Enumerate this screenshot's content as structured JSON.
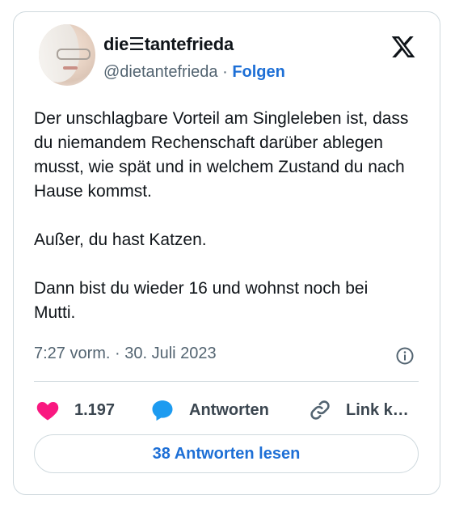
{
  "author": {
    "display_name": "die☰tantefrieda",
    "handle": "@dietantefrieda",
    "separator": "·",
    "follow_label": "Folgen"
  },
  "tweet": {
    "text": "Der unschlagbare Vorteil am Singleleben ist, dass du niemandem Rechenschaft darüber ablegen musst, wie spät und in welchem Zustand du nach Hause kommst.\n\nAußer, du hast Katzen.\n\nDann bist du wieder 16 und wohnst noch bei Mutti.",
    "timestamp": "7:27 vorm. · 30. Juli 2023"
  },
  "actions": {
    "like_count": "1.197",
    "reply_label": "Antworten",
    "link_label": "Link k…"
  },
  "read_replies_label": "38 Antworten lesen",
  "icons": {
    "brand": "x-logo-icon",
    "info": "info-icon",
    "like": "heart-icon",
    "reply": "speech-bubble-icon",
    "link": "link-icon"
  },
  "colors": {
    "heart": "#f91880",
    "reply_bubble": "#1d9bf0",
    "follow_link": "#1d6fd6",
    "border": "#cfd9de",
    "muted_text": "#536471"
  }
}
